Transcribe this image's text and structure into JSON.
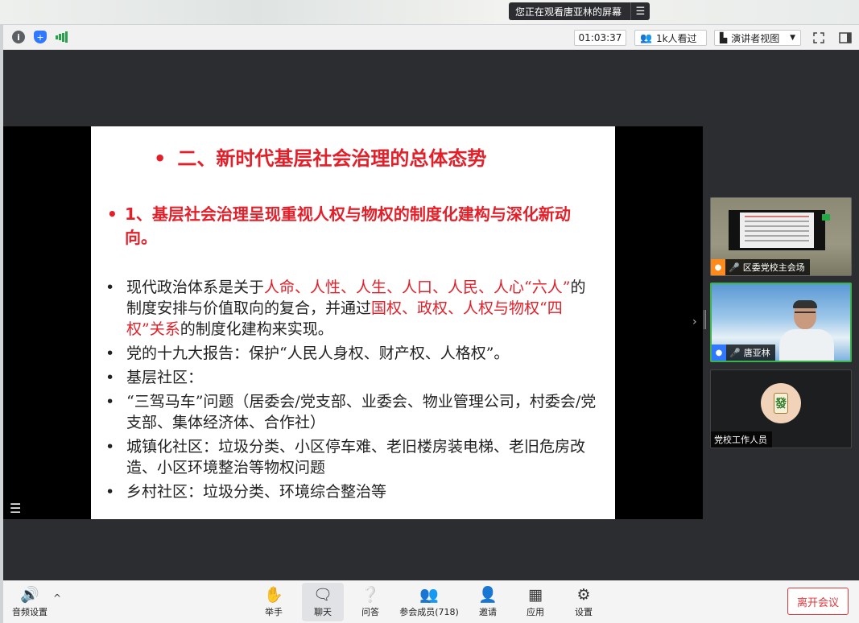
{
  "banner": {
    "text": "您正在观看唐亚林的屏幕",
    "menu_icon": "list-icon"
  },
  "topbar": {
    "timer": "01:03:37",
    "viewers": "1k人看过",
    "presenter_view": "演讲者视图"
  },
  "slide": {
    "title": "二、新时代基层社会治理的总体态势",
    "subtitle": "1、基层社会治理呈现重视人权与物权的制度化建构与深化新动向。",
    "bullets": [
      {
        "parts": [
          {
            "t": "现代政治体系是关于",
            "red": false
          },
          {
            "t": "人命、人性、人生、人口、人民、人心“六人”",
            "red": true
          },
          {
            "t": "的制度安排与价值取向的复合，并通过",
            "red": false
          },
          {
            "t": "国权、政权、人权与物权“四权”关系",
            "red": true
          },
          {
            "t": "的制度化建构来实现。",
            "red": false
          }
        ]
      },
      {
        "parts": [
          {
            "t": "党的十九大报告：保护“人民人身权、财产权、人格权”。",
            "red": false
          }
        ]
      },
      {
        "parts": [
          {
            "t": "基层社区：",
            "red": false
          }
        ]
      },
      {
        "parts": [
          {
            "t": "“三驾马车”问题（居委会/党支部、业委会、物业管理公司，村委会/党支部、集体经济体、合作社）",
            "red": false
          }
        ]
      },
      {
        "parts": [
          {
            "t": "城镇化社区：垃圾分类、小区停车难、老旧楼房装电梯、老旧危房改造、小区环境整治等物权问题",
            "red": false
          }
        ]
      },
      {
        "parts": [
          {
            "t": "乡村社区：垃圾分类、环境综合整治等",
            "red": false
          }
        ]
      }
    ]
  },
  "participants": [
    {
      "name": "区委党校主会场",
      "badge_color": "#ff8a1a"
    },
    {
      "name": "唐亚林",
      "badge_color": "#2f78ff"
    },
    {
      "name": "党校工作人员",
      "avatar_char": "發"
    }
  ],
  "toolbar": {
    "audio": "音频设置",
    "raise_hand": "举手",
    "chat": "聊天",
    "qa": "问答",
    "members": "参会成员(718)",
    "invite": "邀请",
    "apps": "应用",
    "settings": "设置",
    "leave": "离开会议"
  },
  "colors": {
    "accent_red": "#e3202a",
    "speaking_green": "#3bb54a",
    "leave_red": "#e0373d"
  }
}
